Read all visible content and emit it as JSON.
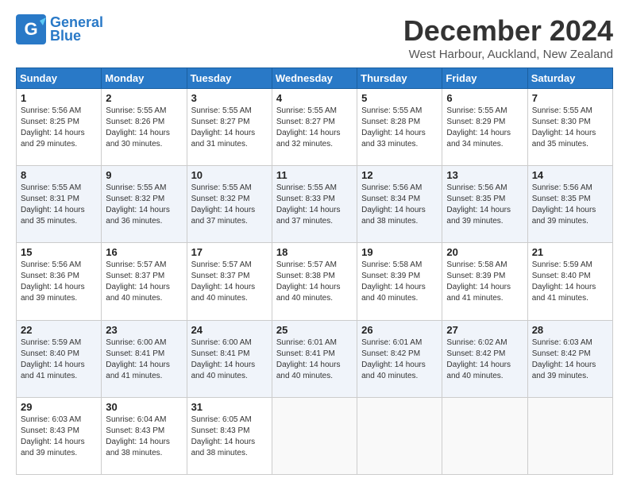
{
  "header": {
    "logo": {
      "line1": "General",
      "line2": "Blue"
    },
    "title": "December 2024",
    "location": "West Harbour, Auckland, New Zealand"
  },
  "calendar": {
    "headers": [
      "Sunday",
      "Monday",
      "Tuesday",
      "Wednesday",
      "Thursday",
      "Friday",
      "Saturday"
    ],
    "weeks": [
      [
        {
          "day": "",
          "info": ""
        },
        {
          "day": "2",
          "info": "Sunrise: 5:55 AM\nSunset: 8:26 PM\nDaylight: 14 hours\nand 30 minutes."
        },
        {
          "day": "3",
          "info": "Sunrise: 5:55 AM\nSunset: 8:27 PM\nDaylight: 14 hours\nand 31 minutes."
        },
        {
          "day": "4",
          "info": "Sunrise: 5:55 AM\nSunset: 8:27 PM\nDaylight: 14 hours\nand 32 minutes."
        },
        {
          "day": "5",
          "info": "Sunrise: 5:55 AM\nSunset: 8:28 PM\nDaylight: 14 hours\nand 33 minutes."
        },
        {
          "day": "6",
          "info": "Sunrise: 5:55 AM\nSunset: 8:29 PM\nDaylight: 14 hours\nand 34 minutes."
        },
        {
          "day": "7",
          "info": "Sunrise: 5:55 AM\nSunset: 8:30 PM\nDaylight: 14 hours\nand 35 minutes."
        }
      ],
      [
        {
          "day": "1",
          "info": "Sunrise: 5:56 AM\nSunset: 8:25 PM\nDaylight: 14 hours\nand 29 minutes."
        },
        {
          "day": "9",
          "info": "Sunrise: 5:55 AM\nSunset: 8:32 PM\nDaylight: 14 hours\nand 36 minutes."
        },
        {
          "day": "10",
          "info": "Sunrise: 5:55 AM\nSunset: 8:32 PM\nDaylight: 14 hours\nand 37 minutes."
        },
        {
          "day": "11",
          "info": "Sunrise: 5:55 AM\nSunset: 8:33 PM\nDaylight: 14 hours\nand 37 minutes."
        },
        {
          "day": "12",
          "info": "Sunrise: 5:56 AM\nSunset: 8:34 PM\nDaylight: 14 hours\nand 38 minutes."
        },
        {
          "day": "13",
          "info": "Sunrise: 5:56 AM\nSunset: 8:35 PM\nDaylight: 14 hours\nand 39 minutes."
        },
        {
          "day": "14",
          "info": "Sunrise: 5:56 AM\nSunset: 8:35 PM\nDaylight: 14 hours\nand 39 minutes."
        }
      ],
      [
        {
          "day": "8",
          "info": "Sunrise: 5:55 AM\nSunset: 8:31 PM\nDaylight: 14 hours\nand 35 minutes."
        },
        {
          "day": "16",
          "info": "Sunrise: 5:57 AM\nSunset: 8:37 PM\nDaylight: 14 hours\nand 40 minutes."
        },
        {
          "day": "17",
          "info": "Sunrise: 5:57 AM\nSunset: 8:37 PM\nDaylight: 14 hours\nand 40 minutes."
        },
        {
          "day": "18",
          "info": "Sunrise: 5:57 AM\nSunset: 8:38 PM\nDaylight: 14 hours\nand 40 minutes."
        },
        {
          "day": "19",
          "info": "Sunrise: 5:58 AM\nSunset: 8:39 PM\nDaylight: 14 hours\nand 40 minutes."
        },
        {
          "day": "20",
          "info": "Sunrise: 5:58 AM\nSunset: 8:39 PM\nDaylight: 14 hours\nand 41 minutes."
        },
        {
          "day": "21",
          "info": "Sunrise: 5:59 AM\nSunset: 8:40 PM\nDaylight: 14 hours\nand 41 minutes."
        }
      ],
      [
        {
          "day": "15",
          "info": "Sunrise: 5:56 AM\nSunset: 8:36 PM\nDaylight: 14 hours\nand 39 minutes."
        },
        {
          "day": "23",
          "info": "Sunrise: 6:00 AM\nSunset: 8:41 PM\nDaylight: 14 hours\nand 41 minutes."
        },
        {
          "day": "24",
          "info": "Sunrise: 6:00 AM\nSunset: 8:41 PM\nDaylight: 14 hours\nand 40 minutes."
        },
        {
          "day": "25",
          "info": "Sunrise: 6:01 AM\nSunset: 8:41 PM\nDaylight: 14 hours\nand 40 minutes."
        },
        {
          "day": "26",
          "info": "Sunrise: 6:01 AM\nSunset: 8:42 PM\nDaylight: 14 hours\nand 40 minutes."
        },
        {
          "day": "27",
          "info": "Sunrise: 6:02 AM\nSunset: 8:42 PM\nDaylight: 14 hours\nand 40 minutes."
        },
        {
          "day": "28",
          "info": "Sunrise: 6:03 AM\nSunset: 8:42 PM\nDaylight: 14 hours\nand 39 minutes."
        }
      ],
      [
        {
          "day": "22",
          "info": "Sunrise: 5:59 AM\nSunset: 8:40 PM\nDaylight: 14 hours\nand 41 minutes."
        },
        {
          "day": "30",
          "info": "Sunrise: 6:04 AM\nSunset: 8:43 PM\nDaylight: 14 hours\nand 38 minutes."
        },
        {
          "day": "31",
          "info": "Sunrise: 6:05 AM\nSunset: 8:43 PM\nDaylight: 14 hours\nand 38 minutes."
        },
        {
          "day": "",
          "info": ""
        },
        {
          "day": "",
          "info": ""
        },
        {
          "day": "",
          "info": ""
        },
        {
          "day": "",
          "info": ""
        }
      ],
      [
        {
          "day": "29",
          "info": "Sunrise: 6:03 AM\nSunset: 8:43 PM\nDaylight: 14 hours\nand 39 minutes."
        },
        {
          "day": "",
          "info": ""
        },
        {
          "day": "",
          "info": ""
        },
        {
          "day": "",
          "info": ""
        },
        {
          "day": "",
          "info": ""
        },
        {
          "day": "",
          "info": ""
        },
        {
          "day": "",
          "info": ""
        }
      ]
    ]
  }
}
